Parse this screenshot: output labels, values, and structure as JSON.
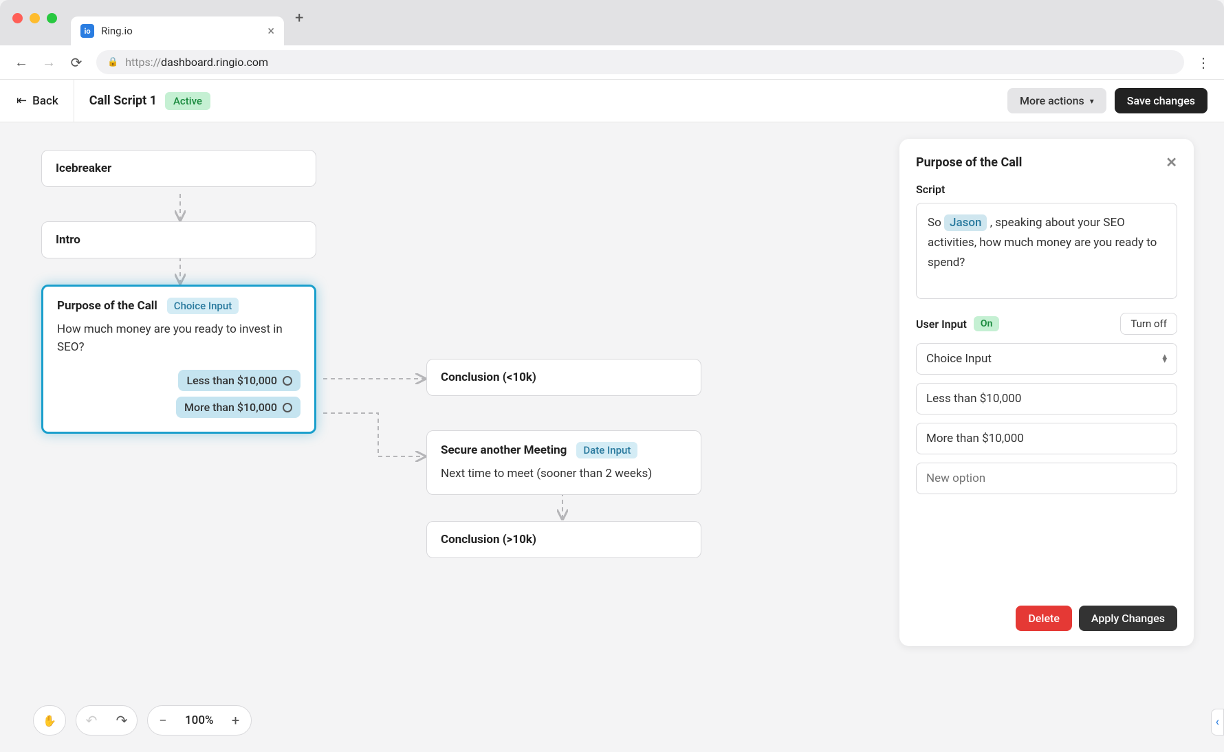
{
  "browser": {
    "tab_title": "Ring.io",
    "favicon": "io",
    "url_proto": "https://",
    "url_domain": "dashboard.ringio.com"
  },
  "header": {
    "back_label": "Back",
    "title": "Call Script 1",
    "status": "Active",
    "more_actions": "More actions",
    "save": "Save changes"
  },
  "nodes": {
    "icebreaker": {
      "title": "Icebreaker"
    },
    "intro": {
      "title": "Intro"
    },
    "purpose": {
      "title": "Purpose of the Call",
      "tag": "Choice Input",
      "body": "How much money are you ready to invest in SEO?",
      "choice1": "Less than $10,000",
      "choice2": "More than $10,000"
    },
    "conclusion_lt": {
      "title": "Conclusion (<10k)"
    },
    "meeting": {
      "title": "Secure another Meeting",
      "tag": "Date Input",
      "body": "Next time to meet (sooner than 2 weeks)"
    },
    "conclusion_gt": {
      "title": "Conclusion (>10k)"
    }
  },
  "panel": {
    "title": "Purpose of the Call",
    "script_label": "Script",
    "script_prefix": "So ",
    "mention": "Jason",
    "script_suffix": ", speaking about your SEO activities, how much money are you ready to spend?",
    "user_input_label": "User Input",
    "user_input_status": "On",
    "turn_off": "Turn off",
    "input_type": "Choice Input",
    "option1": "Less than $10,000",
    "option2": "More than $10,000",
    "new_option_placeholder": "New option",
    "delete": "Delete",
    "apply": "Apply Changes"
  },
  "zoom": {
    "level": "100%"
  }
}
